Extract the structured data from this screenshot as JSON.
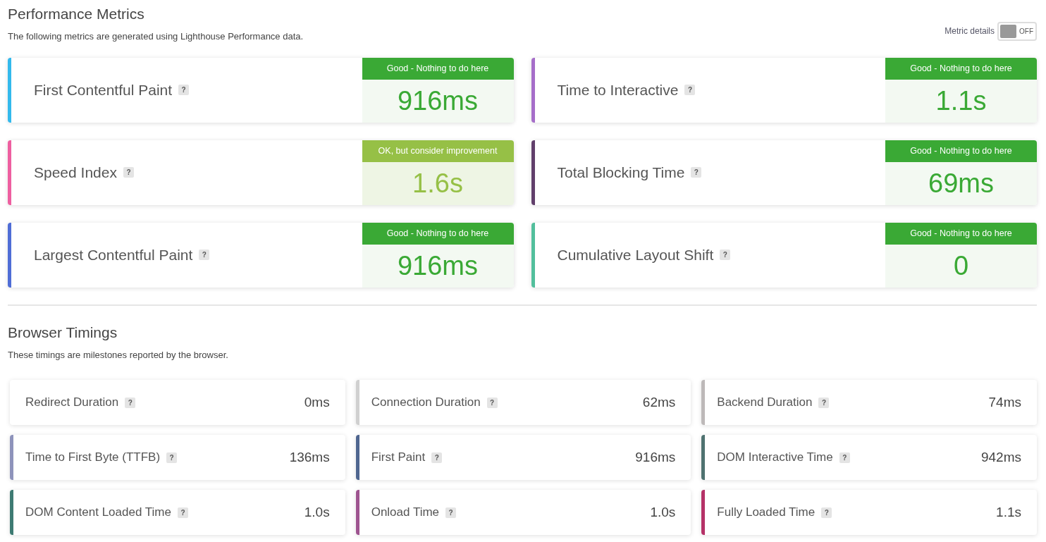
{
  "performance": {
    "title": "Performance Metrics",
    "description": "The following metrics are generated using Lighthouse Performance data.",
    "toggle": {
      "label": "Metric details",
      "on": false,
      "state_text": "OFF"
    },
    "metrics": [
      {
        "label": "First Contentful Paint",
        "help": "?",
        "kind": "good",
        "grade_text": "Good - Nothing to do here",
        "value": "916ms",
        "color": "#33b9ec"
      },
      {
        "label": "Time to Interactive",
        "help": "?",
        "kind": "good",
        "grade_text": "Good - Nothing to do here",
        "value": "1.1s",
        "color": "#a66ec9"
      },
      {
        "label": "Speed Index",
        "help": "?",
        "kind": "ok",
        "grade_text": "OK, but consider improvement",
        "value": "1.6s",
        "color": "#ee5fa0"
      },
      {
        "label": "Total Blocking Time",
        "help": "?",
        "kind": "good",
        "grade_text": "Good - Nothing to do here",
        "value": "69ms",
        "color": "#613f6b"
      },
      {
        "label": "Largest Contentful Paint",
        "help": "?",
        "kind": "good",
        "grade_text": "Good - Nothing to do here",
        "value": "916ms",
        "color": "#4f6dd6"
      },
      {
        "label": "Cumulative Layout Shift",
        "help": "?",
        "kind": "good",
        "grade_text": "Good - Nothing to do here",
        "value": "0",
        "color": "#52bf9c"
      }
    ]
  },
  "browser_timings": {
    "title": "Browser Timings",
    "description": "These timings are milestones reported by the browser.",
    "timings": [
      {
        "label": "Redirect Duration",
        "help": "?",
        "value": "0ms"
      },
      {
        "label": "Connection Duration",
        "help": "?",
        "value": "62ms",
        "color": "#d0d0d0"
      },
      {
        "label": "Backend Duration",
        "help": "?",
        "value": "74ms",
        "color": "#bdb9b9"
      },
      {
        "label": "Time to First Byte (TTFB)",
        "help": "?",
        "value": "136ms",
        "color": "#8e93bb"
      },
      {
        "label": "First Paint",
        "help": "?",
        "value": "916ms",
        "color": "#4f6690"
      },
      {
        "label": "DOM Interactive Time",
        "help": "?",
        "value": "942ms",
        "color": "#4f7270"
      },
      {
        "label": "DOM Content Loaded Time",
        "help": "?",
        "value": "1.0s",
        "color": "#3e7b73"
      },
      {
        "label": "Onload Time",
        "help": "?",
        "value": "1.0s",
        "color": "#9e5490"
      },
      {
        "label": "Fully Loaded Time",
        "help": "?",
        "value": "1.1s",
        "color": "#b53167"
      }
    ]
  }
}
